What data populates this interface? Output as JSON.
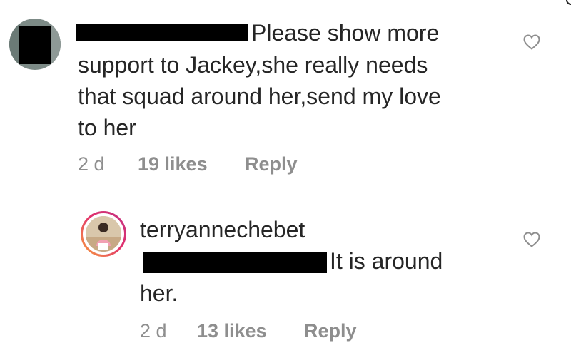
{
  "comments": [
    {
      "username_redacted": true,
      "text_first_line": "Please show more",
      "text_lines": [
        "support to Jackey,she really needs",
        "that squad around her,send my love",
        "to her"
      ],
      "time": "2 d",
      "likes": "19 likes",
      "reply_label": "Reply"
    },
    {
      "username": "terryannechebet",
      "mention_redacted": true,
      "text_first_line": "It is around",
      "text_lines": [
        "her."
      ],
      "time": "2 d",
      "likes": "13 likes",
      "reply_label": "Reply"
    }
  ],
  "icons": {
    "like": "heart-outline-icon"
  }
}
